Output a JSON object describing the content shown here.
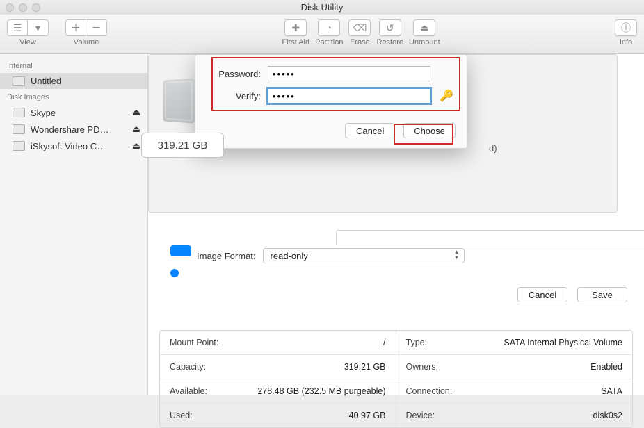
{
  "window": {
    "title": "Disk Utility"
  },
  "toolbar": {
    "view": "View",
    "volume": "Volume",
    "firstaid": "First Aid",
    "partition": "Partition",
    "erase": "Erase",
    "restore": "Restore",
    "unmount": "Unmount",
    "info": "Info"
  },
  "sidebar": {
    "section_internal": "Internal",
    "section_diskimages": "Disk Images",
    "items": [
      {
        "label": "Untitled"
      },
      {
        "label": "Skype"
      },
      {
        "label": "Wondershare PD…"
      },
      {
        "label": "iSkysoft Video C…"
      }
    ]
  },
  "content": {
    "capacity_badge": "319.21 GB",
    "trailing_text": "d)",
    "image_format_label": "Image Format:",
    "image_format_value": "read-only",
    "cancel": "Cancel",
    "save": "Save"
  },
  "info": {
    "rows": [
      {
        "k": "Mount Point:",
        "v": "/"
      },
      {
        "k": "Type:",
        "v": "SATA Internal Physical Volume"
      },
      {
        "k": "Capacity:",
        "v": "319.21 GB"
      },
      {
        "k": "Owners:",
        "v": "Enabled"
      },
      {
        "k": "Available:",
        "v": "278.48 GB (232.5 MB purgeable)"
      },
      {
        "k": "Connection:",
        "v": "SATA"
      },
      {
        "k": "Used:",
        "v": "40.97 GB"
      },
      {
        "k": "Device:",
        "v": "disk0s2"
      }
    ]
  },
  "sheet": {
    "password_label": "Password:",
    "verify_label": "Verify:",
    "password_value": "•••••",
    "verify_value": "•••••",
    "cancel": "Cancel",
    "choose": "Choose"
  }
}
